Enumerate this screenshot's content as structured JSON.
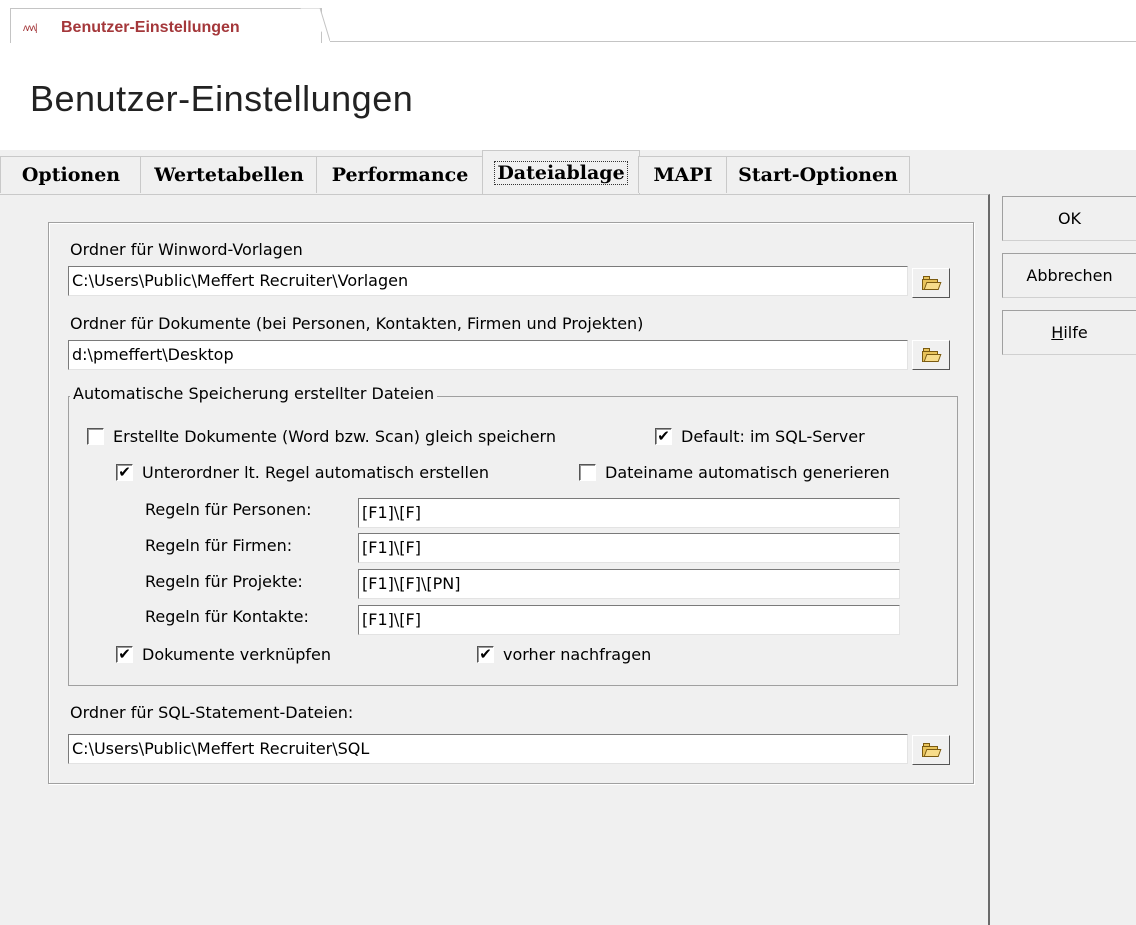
{
  "doc_tab": {
    "icon": "хсж|",
    "label": "Benutzer-Einstellungen"
  },
  "page_title": "Benutzer-Einstellungen",
  "tabs": [
    {
      "label": "Optionen",
      "active": false
    },
    {
      "label": "Wertetabellen",
      "active": false
    },
    {
      "label": "Performance",
      "active": false
    },
    {
      "label": "Dateiablage",
      "active": true
    },
    {
      "label": "MAPI",
      "active": false
    },
    {
      "label": "Start-Optionen",
      "active": false
    }
  ],
  "buttons": {
    "ok": "OK",
    "cancel": "Abbrechen",
    "help_prefix": "H",
    "help_rest": "ilfe"
  },
  "winword": {
    "label": "Ordner für Winword-Vorlagen",
    "value": "C:\\Users\\Public\\Meffert Recruiter\\Vorlagen"
  },
  "documents": {
    "label": "Ordner für Dokumente (bei Personen, Kontakten, Firmen und Projekten)",
    "value": "d:\\pmeffert\\Desktop"
  },
  "auto_save": {
    "legend": "Automatische Speicherung erstellter Dateien",
    "save_now": {
      "label": "Erstellte Dokumente (Word bzw. Scan) gleich speichern",
      "checked": false
    },
    "default_sql": {
      "label": "Default: im SQL-Server",
      "checked": true
    },
    "subfolder": {
      "label": "Unterordner lt. Regel automatisch erstellen",
      "checked": true
    },
    "filename": {
      "label": "Dateiname automatisch generieren",
      "checked": false
    },
    "rules": {
      "persons": {
        "label": "Regeln für Personen:",
        "value": "[F1]\\[F]"
      },
      "firms": {
        "label": "Regeln für Firmen:",
        "value": "[F1]\\[F]"
      },
      "projects": {
        "label": "Regeln für Projekte:",
        "value": "[F1]\\[F]\\[PN]"
      },
      "contacts": {
        "label": "Regeln für Kontakte:",
        "value": "[F1]\\[F]"
      }
    },
    "link_docs": {
      "label": "Dokumente verknüpfen",
      "checked": true
    },
    "ask_before": {
      "label": "vorher nachfragen",
      "checked": true
    }
  },
  "sql": {
    "label": "Ordner für SQL-Statement-Dateien:",
    "value": "C:\\Users\\Public\\Meffert Recruiter\\SQL"
  },
  "check_mark": "✔"
}
